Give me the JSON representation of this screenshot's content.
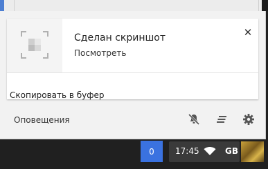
{
  "notification": {
    "title": "Сделан скриншот",
    "action_label": "Посмотреть",
    "copy_label": "Скопировать в буфер",
    "close_icon": "close-icon",
    "thumbnail_icon": "screenshot-thumbnail-icon"
  },
  "footer": {
    "label": "Оповещения",
    "icons": [
      "notifications-off-icon",
      "clear-all-icon",
      "settings-icon"
    ]
  },
  "shelf": {
    "notification_count": "0",
    "time": "17:45",
    "network_icon": "wifi-icon",
    "ime_label": "GB",
    "avatar_icon": "user-avatar"
  },
  "colors": {
    "badge": "#3a72e0",
    "tray": "#3a3a3a",
    "panel": "#f2f2f2"
  }
}
